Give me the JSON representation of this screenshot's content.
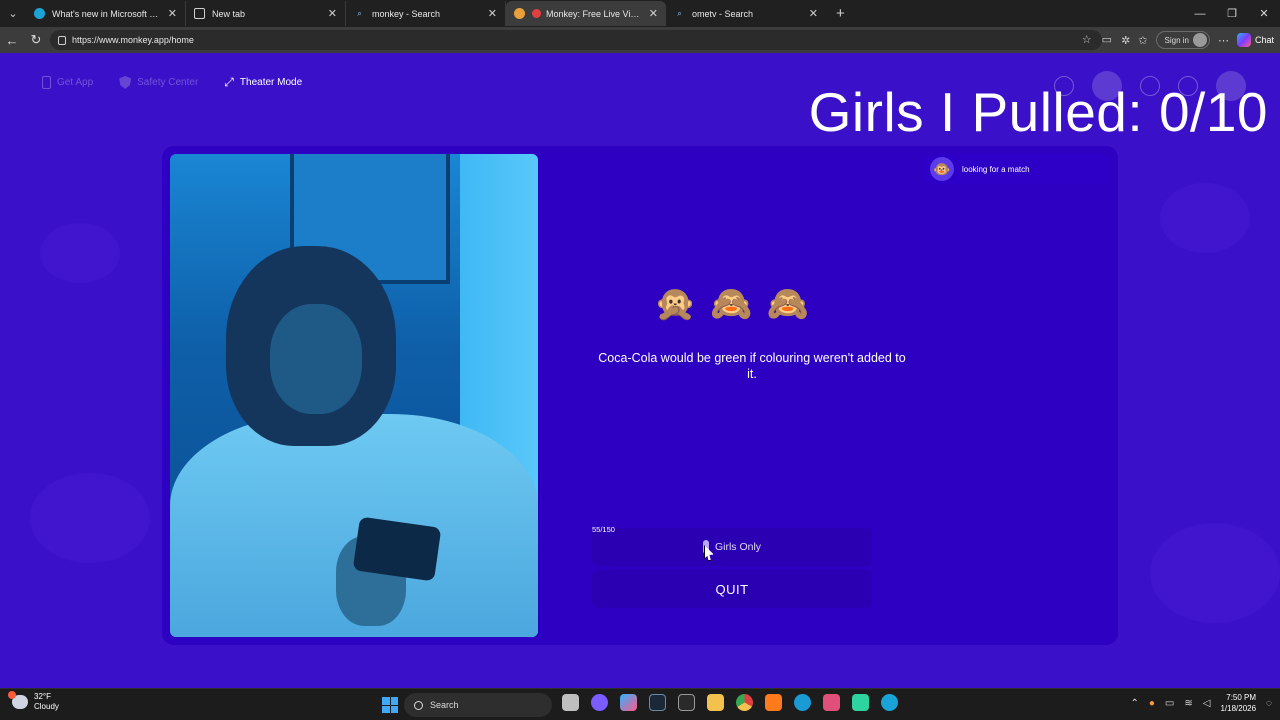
{
  "browser": {
    "tabs": [
      {
        "label": "What's new in Microsoft Edge",
        "favicon": "edge-icon",
        "active": false
      },
      {
        "label": "New tab",
        "favicon": "newtab-icon",
        "active": false
      },
      {
        "label": "monkey - Search",
        "favicon": "search-icon",
        "active": false
      },
      {
        "label": "Monkey: Free Live Video Chat",
        "favicon": "monkey-icon",
        "active": true
      },
      {
        "label": "ometv - Search",
        "favicon": "search-icon",
        "active": false
      }
    ],
    "url": "https://www.monkey.app/home",
    "signin_label": "Sign in",
    "chat_label": "Chat"
  },
  "page": {
    "nav": {
      "get_app": "Get App",
      "safety_center": "Safety Center",
      "theater_mode": "Theater Mode"
    },
    "overlay_title": "Girls I Pulled: 0/10",
    "emojis": [
      "🙊",
      "🙈",
      "🙈"
    ],
    "fact": "Coca-Cola would be green if colouring weren't added to it.",
    "counter": "55/150",
    "girls_only_label": "Girls Only",
    "quit_label": "QUIT",
    "status": {
      "avatar": "🐵",
      "text": "looking for a match"
    },
    "colors": {
      "background": "#3a10c8",
      "card": "#2d00c2"
    }
  },
  "taskbar": {
    "weather_temp": "32°F",
    "weather_desc": "Cloudy",
    "search_label": "Search",
    "time": "7:50 PM",
    "date": "1/18/2026"
  }
}
